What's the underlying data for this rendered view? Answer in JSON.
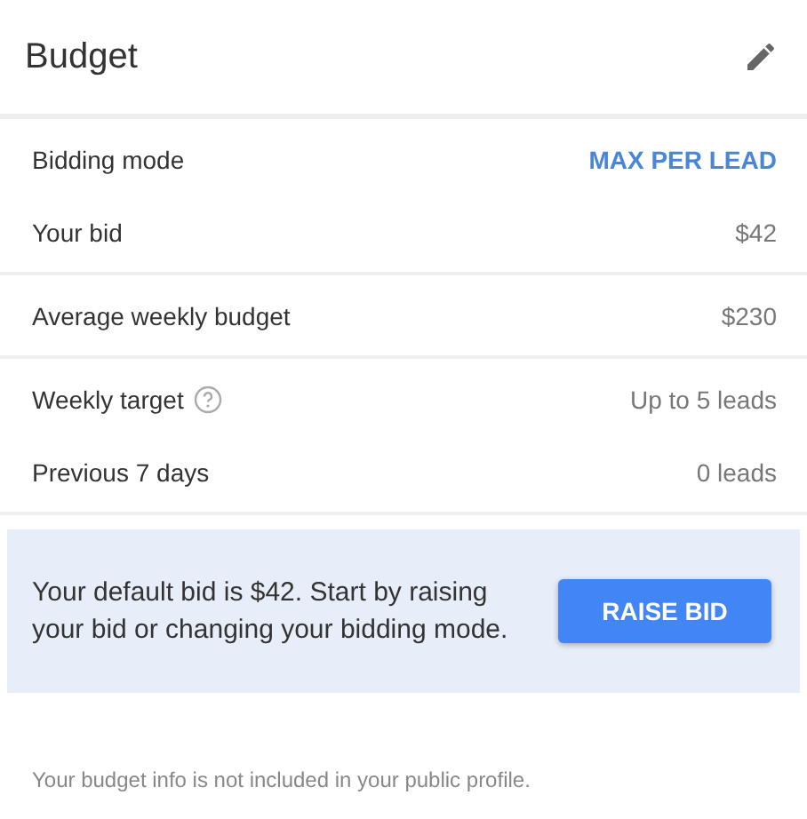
{
  "header": {
    "title": "Budget"
  },
  "sections": [
    {
      "rows": [
        {
          "label": "Bidding mode",
          "value": "MAX PER LEAD",
          "kind": "link",
          "help": false
        },
        {
          "label": "Your bid",
          "value": "$42",
          "kind": "text",
          "help": false
        }
      ]
    },
    {
      "rows": [
        {
          "label": "Average weekly budget",
          "value": "$230",
          "kind": "text",
          "help": false
        }
      ]
    },
    {
      "rows": [
        {
          "label": "Weekly target",
          "value": "Up to 5 leads",
          "kind": "text",
          "help": true
        },
        {
          "label": "Previous 7 days",
          "value": "0 leads",
          "kind": "text",
          "help": false
        }
      ]
    }
  ],
  "notice": {
    "message": "Your default bid is $42. Start by raising your bid or changing your bidding mode.",
    "button": "RAISE BID"
  },
  "footer": "Your budget info is not included in your public profile."
}
